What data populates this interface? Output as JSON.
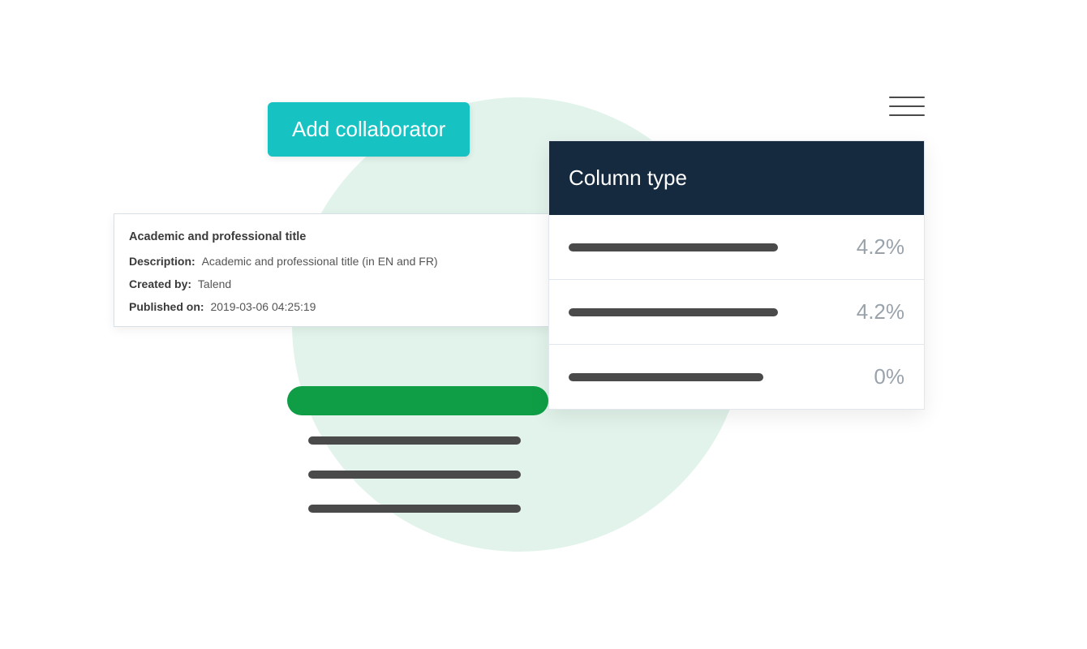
{
  "add_collaborator": {
    "label": "Add collaborator"
  },
  "info_card": {
    "title": "Academic and professional title",
    "description_label": "Description:",
    "description_value": "Academic and professional title (in EN and FR)",
    "created_by_label": "Created by:",
    "created_by_value": "Talend",
    "published_on_label": "Published on:",
    "published_on_value": "2019-03-06 04:25:19"
  },
  "column_type_panel": {
    "title": "Column type",
    "rows": [
      {
        "percent": "4.2%"
      },
      {
        "percent": "4.2%"
      },
      {
        "percent": "0%"
      }
    ]
  }
}
